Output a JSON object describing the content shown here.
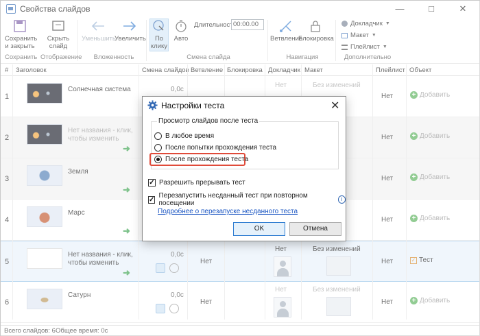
{
  "window": {
    "title": "Свойства слайдов"
  },
  "ribbon": {
    "save_close": "Сохранить\nи закрыть",
    "hide_slide": "Скрыть\nслайд",
    "decrease": "Уменьшить",
    "increase": "Увеличить",
    "on_click": "По\nклику",
    "auto": "Авто",
    "duration_label": "Длительность:",
    "duration_value": "00:00.00",
    "branching": "Ветвление",
    "lock": "Блокировка",
    "narrator": "Докладчик",
    "layout": "Макет",
    "player": "Плейлист",
    "groups": {
      "save": "Сохранить",
      "display": "Отображение",
      "nesting": "Вложенность",
      "transition": "Смена слайда",
      "navigation": "Навигация",
      "additional": "Дополнительно"
    }
  },
  "table": {
    "headers": {
      "num": "#",
      "title": "Заголовок",
      "transition": "Смена слайдов",
      "branch": "Ветвление",
      "lock": "Блокировка",
      "narrator": "Докладчик",
      "layout": "Макет",
      "playlist": "Плейлист",
      "object": "Объект"
    },
    "rows": [
      {
        "num": "1",
        "title": "Солнечная система",
        "time": "0,0с",
        "narrator": "Нет",
        "layout": "Без изменений",
        "playlist": "Нет",
        "object": "Добавить"
      },
      {
        "num": "2",
        "title": "Нет названия - клик, чтобы изменить",
        "time": "",
        "narrator": "",
        "layout": "",
        "playlist": "Нет",
        "object": "Добавить"
      },
      {
        "num": "3",
        "title": "Земля",
        "time": "",
        "narrator": "",
        "layout": "",
        "playlist": "Нет",
        "object": "Добавить"
      },
      {
        "num": "4",
        "title": "Марс",
        "time": "",
        "narrator": "",
        "layout": "",
        "playlist": "Нет",
        "object": "Добавить"
      },
      {
        "num": "5",
        "title": "Нет названия - клик, чтобы изменить",
        "time": "0,0с",
        "branch": "Нет",
        "narrator": "Нет",
        "layout": "Без изменений",
        "playlist": "Нет",
        "object": "Тест"
      },
      {
        "num": "6",
        "title": "Сатурн",
        "time": "0,0с",
        "branch": "Нет",
        "narrator": "Нет",
        "layout": "Без изменений",
        "playlist": "Нет",
        "object": "Добавить"
      }
    ]
  },
  "status": {
    "total_slides": "Всего слайдов: 6",
    "total_time": "Общее время:  0с"
  },
  "dialog": {
    "title": "Настройки теста",
    "group_label": "Просмотр слайдов после теста",
    "options": [
      "В любое время",
      "После попытки прохождения теста",
      "После прохождения теста"
    ],
    "selected_option": 2,
    "allow_interrupt": "Разрешить прерывать тест",
    "restart_unfinished": "Перезапустить несданный тест при повторном посещении",
    "more_link": "Подробнее о перезапуске несданного теста",
    "ok": "OK",
    "cancel": "Отмена"
  },
  "colors": {
    "accent": "#2f7dd1",
    "highlight": "#e04b3a",
    "add_green": "#58b15a",
    "arrow_green": "#3aa24d"
  }
}
